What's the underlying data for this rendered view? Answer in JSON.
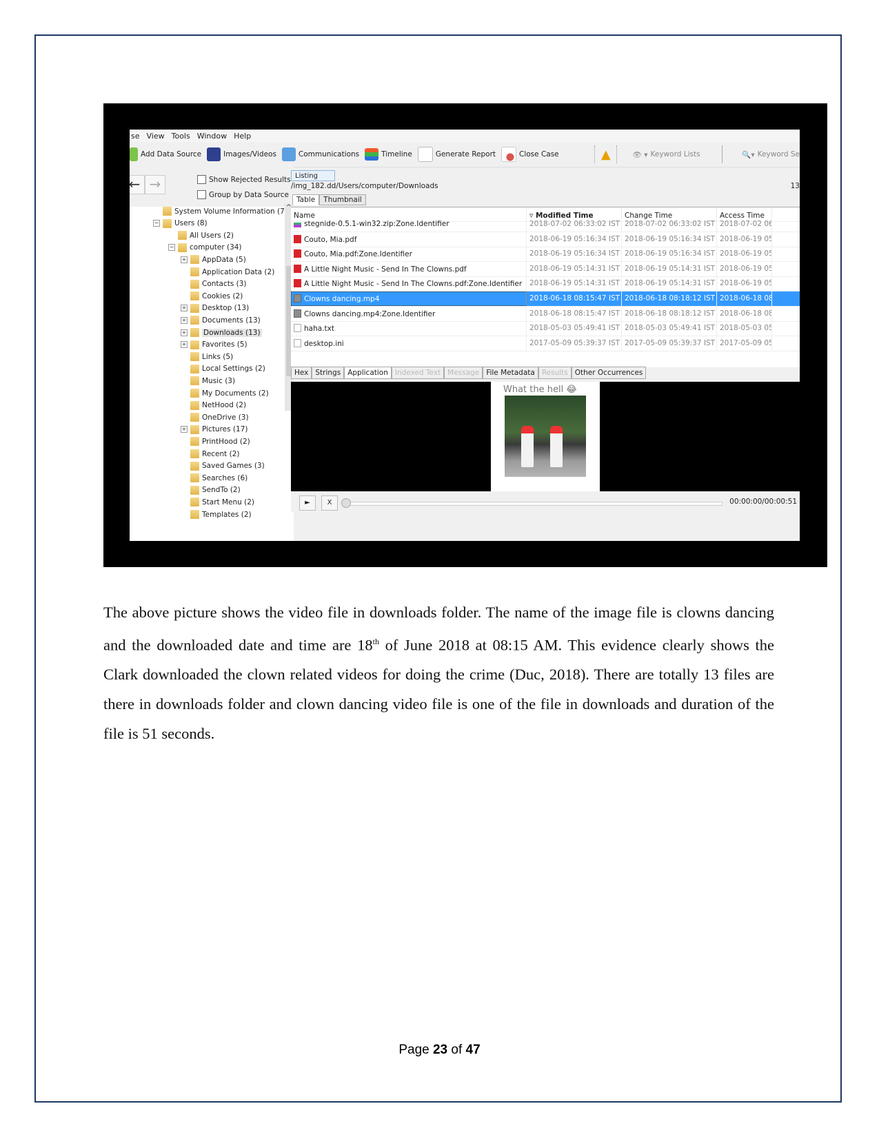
{
  "app": {
    "menu": [
      "se",
      "View",
      "Tools",
      "Window",
      "Help"
    ],
    "toolbar": [
      {
        "label": "Add Data Source",
        "icon": "add-data-source-icon"
      },
      {
        "label": "Images/Videos",
        "icon": "images-videos-icon"
      },
      {
        "label": "Communications",
        "icon": "communications-icon"
      },
      {
        "label": "Timeline",
        "icon": "timeline-icon"
      },
      {
        "label": "Generate Report",
        "icon": "generate-report-icon"
      },
      {
        "label": "Close Case",
        "icon": "close-case-icon"
      }
    ],
    "keyword_lists": "Keyword Lists",
    "keyword_search": "Keyword Se",
    "show_rejected": "Show Rejected Results",
    "group_by_source": "Group by Data Source",
    "tree": [
      {
        "label": "System Volume Information (7)",
        "level": 1
      },
      {
        "label": "Users (8)",
        "level": 1,
        "expander": "−"
      },
      {
        "label": "All Users (2)",
        "level": 2
      },
      {
        "label": "computer (34)",
        "level": 2,
        "expander": "−"
      },
      {
        "label": "AppData (5)",
        "level": 3,
        "expander": "+"
      },
      {
        "label": "Application Data (2)",
        "level": 3
      },
      {
        "label": "Contacts (3)",
        "level": 3
      },
      {
        "label": "Cookies (2)",
        "level": 3
      },
      {
        "label": "Desktop (13)",
        "level": 3,
        "expander": "+"
      },
      {
        "label": "Documents (13)",
        "level": 3,
        "expander": "+"
      },
      {
        "label": "Downloads (13)",
        "level": 3,
        "expander": "+",
        "selected": true
      },
      {
        "label": "Favorites (5)",
        "level": 3,
        "expander": "+"
      },
      {
        "label": "Links (5)",
        "level": 3
      },
      {
        "label": "Local Settings (2)",
        "level": 3
      },
      {
        "label": "Music (3)",
        "level": 3
      },
      {
        "label": "My Documents (2)",
        "level": 3
      },
      {
        "label": "NetHood (2)",
        "level": 3
      },
      {
        "label": "OneDrive (3)",
        "level": 3
      },
      {
        "label": "Pictures (17)",
        "level": 3,
        "expander": "+"
      },
      {
        "label": "PrintHood (2)",
        "level": 3
      },
      {
        "label": "Recent (2)",
        "level": 3
      },
      {
        "label": "Saved Games (3)",
        "level": 3
      },
      {
        "label": "Searches (6)",
        "level": 3
      },
      {
        "label": "SendTo (2)",
        "level": 3
      },
      {
        "label": "Start Menu (2)",
        "level": 3
      },
      {
        "label": "Templates (2)",
        "level": 3
      }
    ],
    "listing_tab": "Listing",
    "path": "/img_182.dd/Users/computer/Downloads",
    "path_count": "13",
    "view_tabs": [
      "Table",
      "Thumbnail"
    ],
    "columns": [
      "Name",
      "Modified Time",
      "Change Time",
      "Access Time"
    ],
    "rows": [
      {
        "name": "stegnide-0.5.1-win32.zip:Zone.Identifier",
        "type": "zip",
        "modified": "2018-07-02 06:33:02 IST",
        "change": "2018-07-02 06:33:02 IST",
        "access": "2018-07-02 06:"
      },
      {
        "name": "Couto, Mia.pdf",
        "type": "pdf",
        "modified": "2018-06-19 05:16:34 IST",
        "change": "2018-06-19 05:16:34 IST",
        "access": "2018-06-19 05:"
      },
      {
        "name": "Couto, Mia.pdf:Zone.Identifier",
        "type": "pdf",
        "modified": "2018-06-19 05:16:34 IST",
        "change": "2018-06-19 05:16:34 IST",
        "access": "2018-06-19 05:"
      },
      {
        "name": "A Little Night Music - Send In The Clowns.pdf",
        "type": "pdf",
        "modified": "2018-06-19 05:14:31 IST",
        "change": "2018-06-19 05:14:31 IST",
        "access": "2018-06-19 05:"
      },
      {
        "name": "A Little Night Music - Send In The Clowns.pdf:Zone.Identifier",
        "type": "pdf",
        "modified": "2018-06-19 05:14:31 IST",
        "change": "2018-06-19 05:14:31 IST",
        "access": "2018-06-19 05:"
      },
      {
        "name": "Clowns dancing.mp4",
        "type": "vid",
        "modified": "2018-06-18 08:15:47 IST",
        "change": "2018-06-18 08:18:12 IST",
        "access": "2018-06-18 08:",
        "selected": true
      },
      {
        "name": "Clowns dancing.mp4:Zone.Identifier",
        "type": "vid",
        "modified": "2018-06-18 08:15:47 IST",
        "change": "2018-06-18 08:18:12 IST",
        "access": "2018-06-18 08:"
      },
      {
        "name": "haha.txt",
        "type": "txt",
        "modified": "2018-05-03 05:49:41 IST",
        "change": "2018-05-03 05:49:41 IST",
        "access": "2018-05-03 05:"
      },
      {
        "name": "desktop.ini",
        "type": "txt",
        "modified": "2017-05-09 05:39:37 IST",
        "change": "2017-05-09 05:39:37 IST",
        "access": "2017-05-09 05:"
      }
    ],
    "content_tabs": [
      {
        "label": "Hex"
      },
      {
        "label": "Strings"
      },
      {
        "label": "Application",
        "active": true
      },
      {
        "label": "Indexed Text",
        "disabled": true
      },
      {
        "label": "Message",
        "disabled": true
      },
      {
        "label": "File Metadata"
      },
      {
        "label": "Results",
        "disabled": true
      },
      {
        "label": "Other Occurrences"
      }
    ],
    "video_caption": "What the hell 😂",
    "player": {
      "play": "►",
      "stop": "X",
      "time": "00:00:00/00:00:51",
      "progress": 0
    }
  },
  "document": {
    "paragraph_before": "The above picture shows the video file in downloads folder. The name of the image file is clowns dancing and the downloaded date and time are 18",
    "superscript": "th",
    "paragraph_after": " of June 2018 at 08:15 AM. This evidence clearly shows the Clark downloaded the clown related videos for doing the crime (Duc, 2018). There are totally 13 files are there in downloads folder and clown dancing video file is one of the file in downloads and duration of the file is 51 seconds.",
    "footer": {
      "prefix": "Page ",
      "current": "23",
      "middle": " of ",
      "total": "47"
    }
  }
}
